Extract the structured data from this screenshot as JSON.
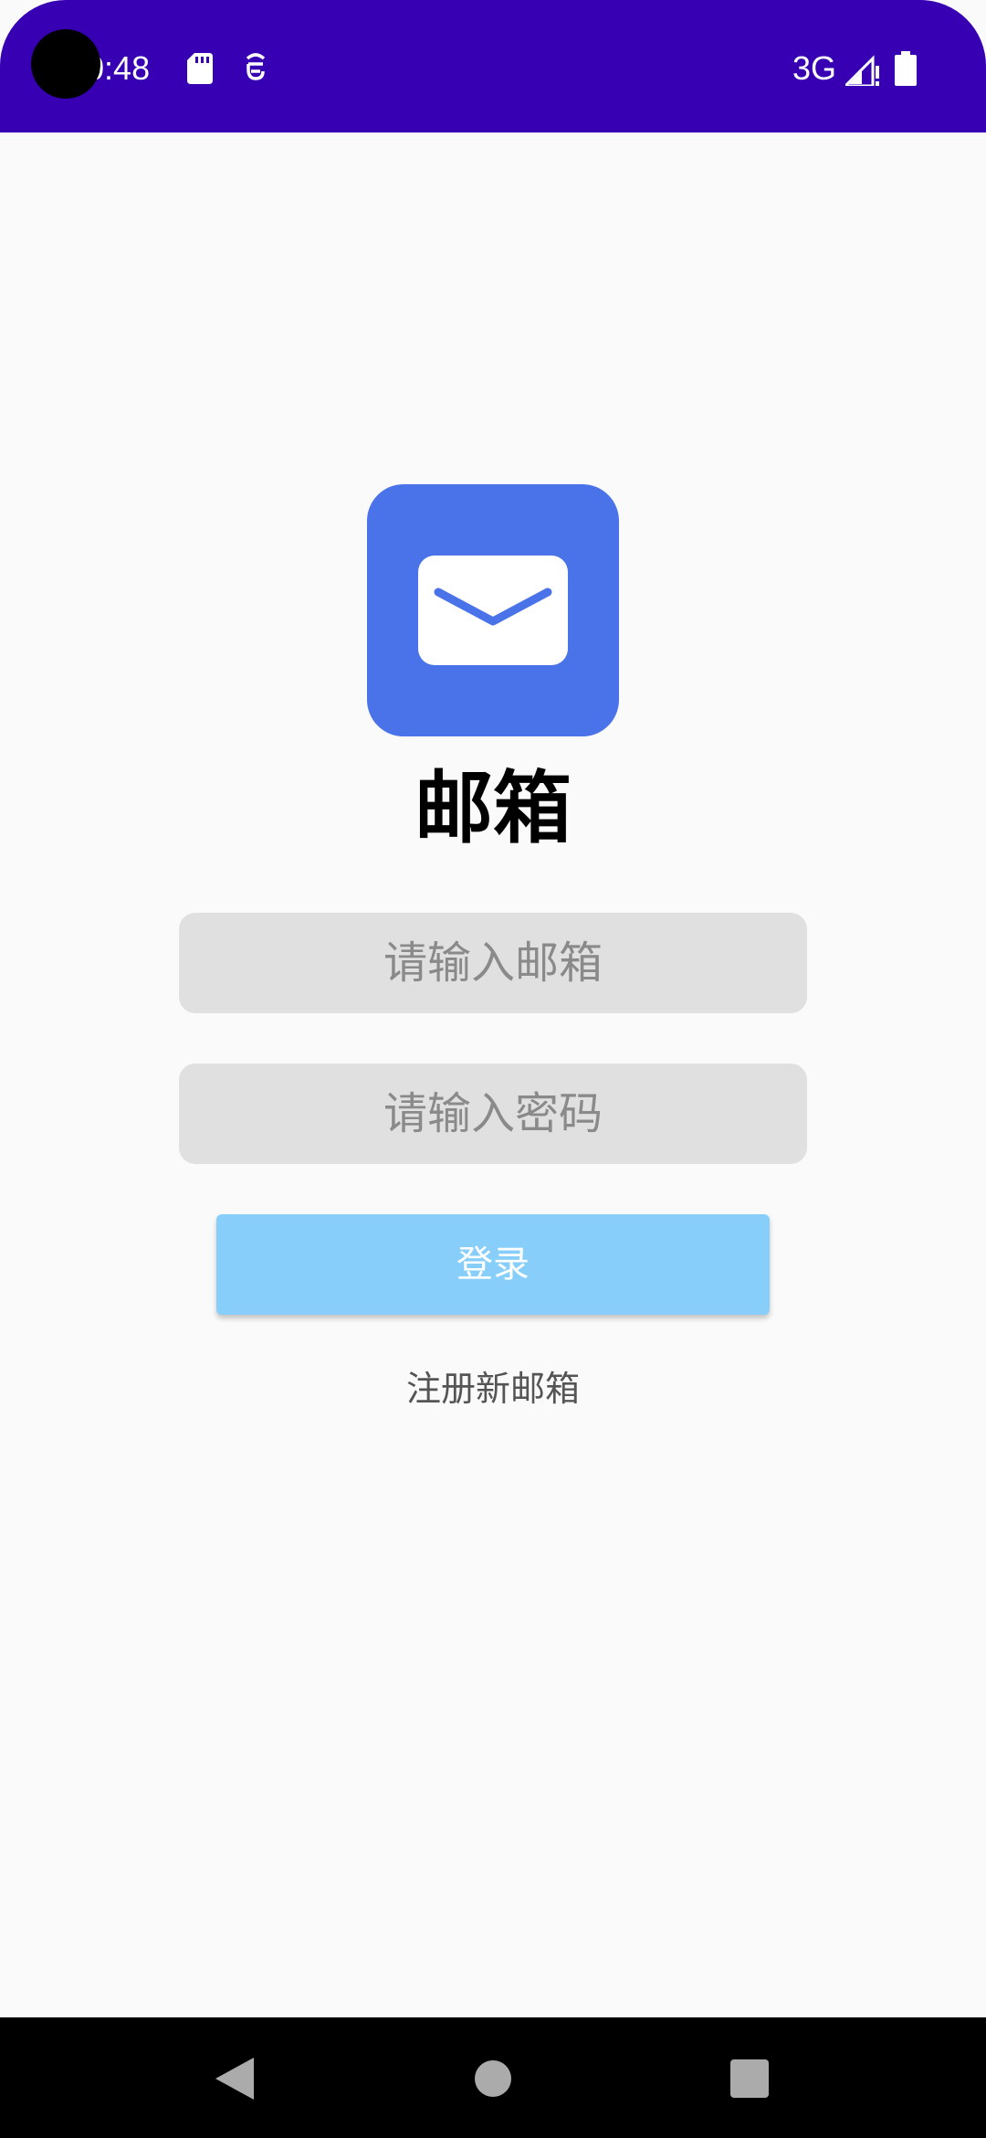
{
  "status_bar": {
    "time": "10:48",
    "network": "3G",
    "background_color": "#3700b3",
    "icons": [
      "sd-card-icon",
      "debug-icon",
      "signal-icon",
      "battery-icon"
    ]
  },
  "app": {
    "logo_icon": "envelope-icon",
    "logo_color": "#4a73ea",
    "title": "邮箱"
  },
  "form": {
    "email_placeholder": "请输入邮箱",
    "email_value": "",
    "password_placeholder": "请输入密码",
    "password_value": "",
    "login_label": "登录",
    "login_color": "#87cefa",
    "register_label": "注册新邮箱"
  },
  "nav_bar": {
    "icons": [
      "back-icon",
      "home-icon",
      "recents-icon"
    ]
  }
}
